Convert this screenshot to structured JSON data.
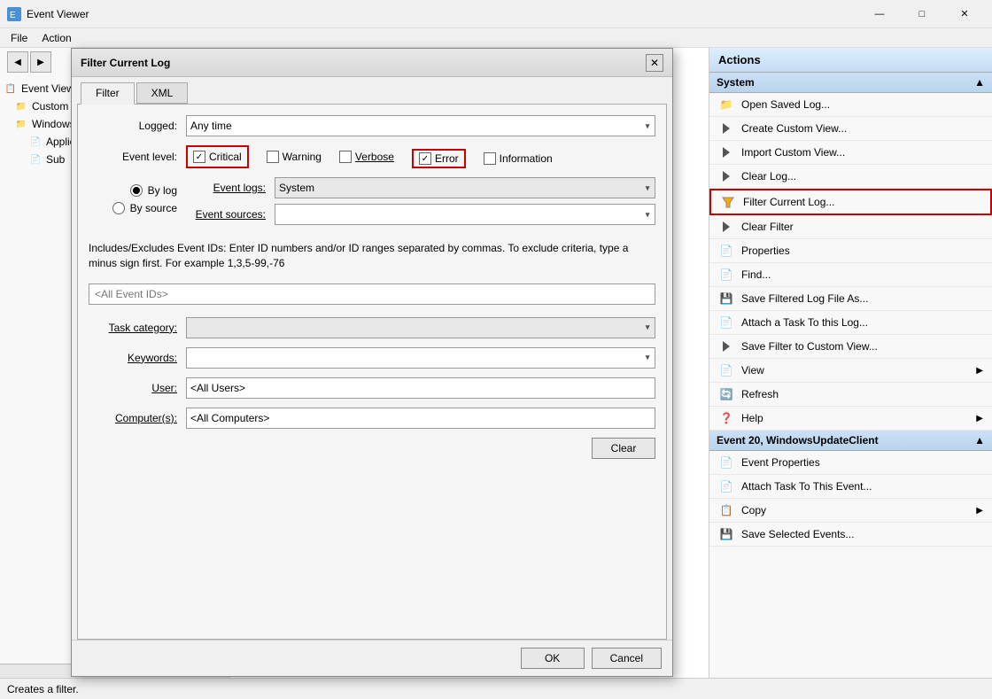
{
  "window": {
    "title": "Event Viewer",
    "minimize_label": "—",
    "maximize_label": "□",
    "close_label": "✕"
  },
  "menu": {
    "items": [
      "File",
      "Action"
    ]
  },
  "left_panel": {
    "nav": {
      "back_label": "◀",
      "forward_label": "▶"
    },
    "tree": [
      {
        "label": "Event Viewer",
        "level": 0,
        "icon": "📋"
      },
      {
        "label": "Custom Views",
        "level": 1,
        "icon": "📁"
      },
      {
        "label": "Windows Logs",
        "level": 1,
        "icon": "📁",
        "selected": true
      },
      {
        "label": "Application",
        "level": 2,
        "icon": "📄"
      },
      {
        "label": "Sub",
        "level": 2,
        "icon": "📄"
      }
    ]
  },
  "dialog": {
    "title": "Filter Current Log",
    "close_label": "✕",
    "tabs": [
      {
        "label": "Filter",
        "active": true
      },
      {
        "label": "XML",
        "active": false
      }
    ],
    "form": {
      "logged_label": "Logged:",
      "logged_value": "Any time",
      "logged_placeholder": "Any time",
      "event_level_label": "Event level:",
      "checkboxes": [
        {
          "label": "Critical",
          "checked": true,
          "outlined": true
        },
        {
          "label": "Warning",
          "checked": false,
          "outlined": false
        },
        {
          "label": "Verbose",
          "checked": false,
          "outlined": false
        },
        {
          "label": "Error",
          "checked": true,
          "outlined": true
        },
        {
          "label": "Information",
          "checked": false,
          "outlined": false
        }
      ],
      "radio_by_log": "By log",
      "radio_by_source": "By source",
      "event_logs_label": "Event logs:",
      "event_logs_value": "System",
      "event_sources_label": "Event sources:",
      "event_sources_value": "",
      "info_text": "Includes/Excludes Event IDs: Enter ID numbers and/or ID ranges separated by commas. To exclude criteria, type a minus sign first. For example 1,3,5-99,-76",
      "all_event_ids_placeholder": "<All Event IDs>",
      "task_category_label": "Task category:",
      "task_category_value": "",
      "keywords_label": "Keywords:",
      "keywords_value": "",
      "user_label": "User:",
      "user_value": "<All Users>",
      "computer_label": "Computer(s):",
      "computer_value": "<All Computers>",
      "clear_btn_label": "Clear",
      "ok_btn_label": "OK",
      "cancel_btn_label": "Cancel"
    }
  },
  "actions_panel": {
    "header": "Actions",
    "sections": [
      {
        "title": "System",
        "items": [
          {
            "label": "Open Saved Log...",
            "icon": "📁"
          },
          {
            "label": "Create Custom View...",
            "icon": "🔽"
          },
          {
            "label": "Import Custom View...",
            "icon": "🔽"
          },
          {
            "label": "Clear Log...",
            "icon": "🔽"
          },
          {
            "label": "Filter Current Log...",
            "icon": "🔽",
            "highlighted": true
          },
          {
            "label": "Clear Filter",
            "icon": "🔽"
          },
          {
            "label": "Properties",
            "icon": "📄"
          },
          {
            "label": "Find...",
            "icon": "📄"
          },
          {
            "label": "Save Filtered Log File As...",
            "icon": "💾"
          },
          {
            "label": "Attach a Task To this Log...",
            "icon": "📄"
          },
          {
            "label": "Save Filter to Custom View...",
            "icon": "🔽"
          },
          {
            "label": "View",
            "icon": "📄",
            "has_arrow": true
          },
          {
            "label": "Refresh",
            "icon": "🔄"
          },
          {
            "label": "Help",
            "icon": "❓",
            "has_arrow": true
          }
        ]
      },
      {
        "title": "Event 20, WindowsUpdateClient",
        "items": [
          {
            "label": "Event Properties",
            "icon": "📄"
          },
          {
            "label": "Attach Task To This Event...",
            "icon": "📄"
          },
          {
            "label": "Copy",
            "icon": "📋",
            "has_arrow": true
          },
          {
            "label": "Save Selected Events...",
            "icon": "💾"
          }
        ]
      }
    ]
  },
  "status_bar": {
    "text": "Creates a filter."
  }
}
